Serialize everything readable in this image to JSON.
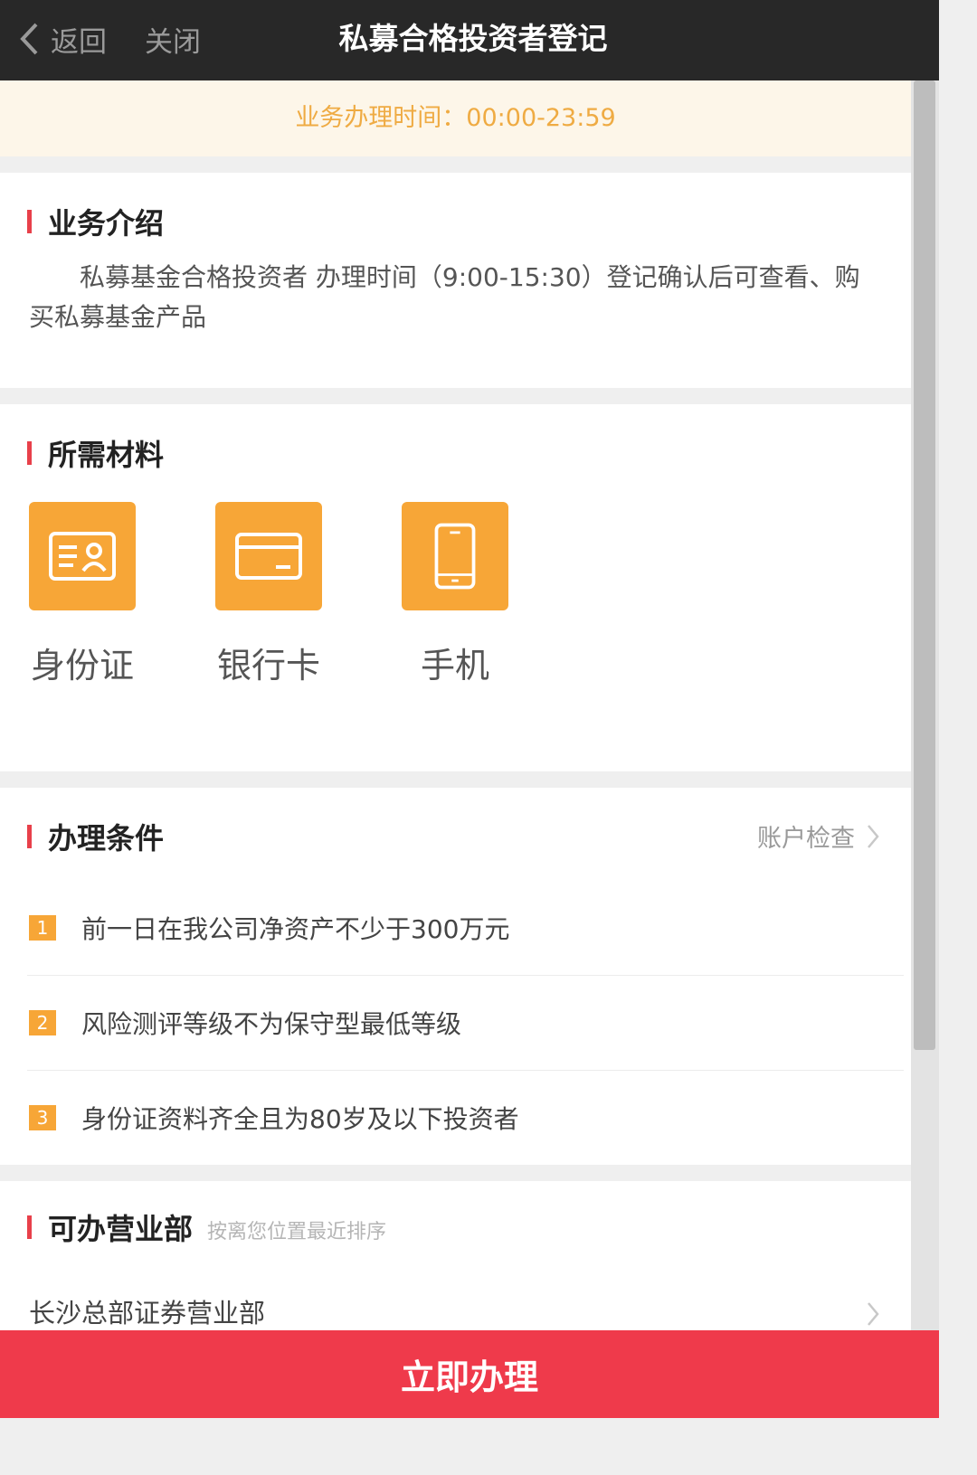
{
  "header": {
    "back_label": "返回",
    "close_label": "关闭",
    "title": "私募合格投资者登记"
  },
  "notice": {
    "text": "业务办理时间：00:00-23:59"
  },
  "intro": {
    "title": "业务介绍",
    "text": "私募基金合格投资者 办理时间（9:00-15:30）登记确认后可查看、购买私募基金产品"
  },
  "materials": {
    "title": "所需材料",
    "items": [
      {
        "label": "身份证",
        "icon": "id-card-icon"
      },
      {
        "label": "银行卡",
        "icon": "bank-card-icon"
      },
      {
        "label": "手机",
        "icon": "mobile-phone-icon"
      }
    ]
  },
  "conditions": {
    "title": "办理条件",
    "account_check_label": "账户检查",
    "items": [
      {
        "num": "1",
        "text": "前一日在我公司净资产不少于300万元"
      },
      {
        "num": "2",
        "text": "风险测评等级不为保守型最低等级"
      },
      {
        "num": "3",
        "text": "身份证资料齐全且为80岁及以下投资者"
      }
    ]
  },
  "branches": {
    "title": "可办营业部",
    "subtitle": "按离您位置最近排序",
    "items": [
      {
        "name": "长沙总部证券营业部"
      }
    ]
  },
  "submit": {
    "label": "立即办理"
  },
  "colors": {
    "header_bg": "#282828",
    "accent_red": "#ef3a4b",
    "section_bar": "#e8404a",
    "icon_orange": "#f7a637",
    "notice_bg": "#fdf6e9",
    "notice_text": "#efab43"
  }
}
